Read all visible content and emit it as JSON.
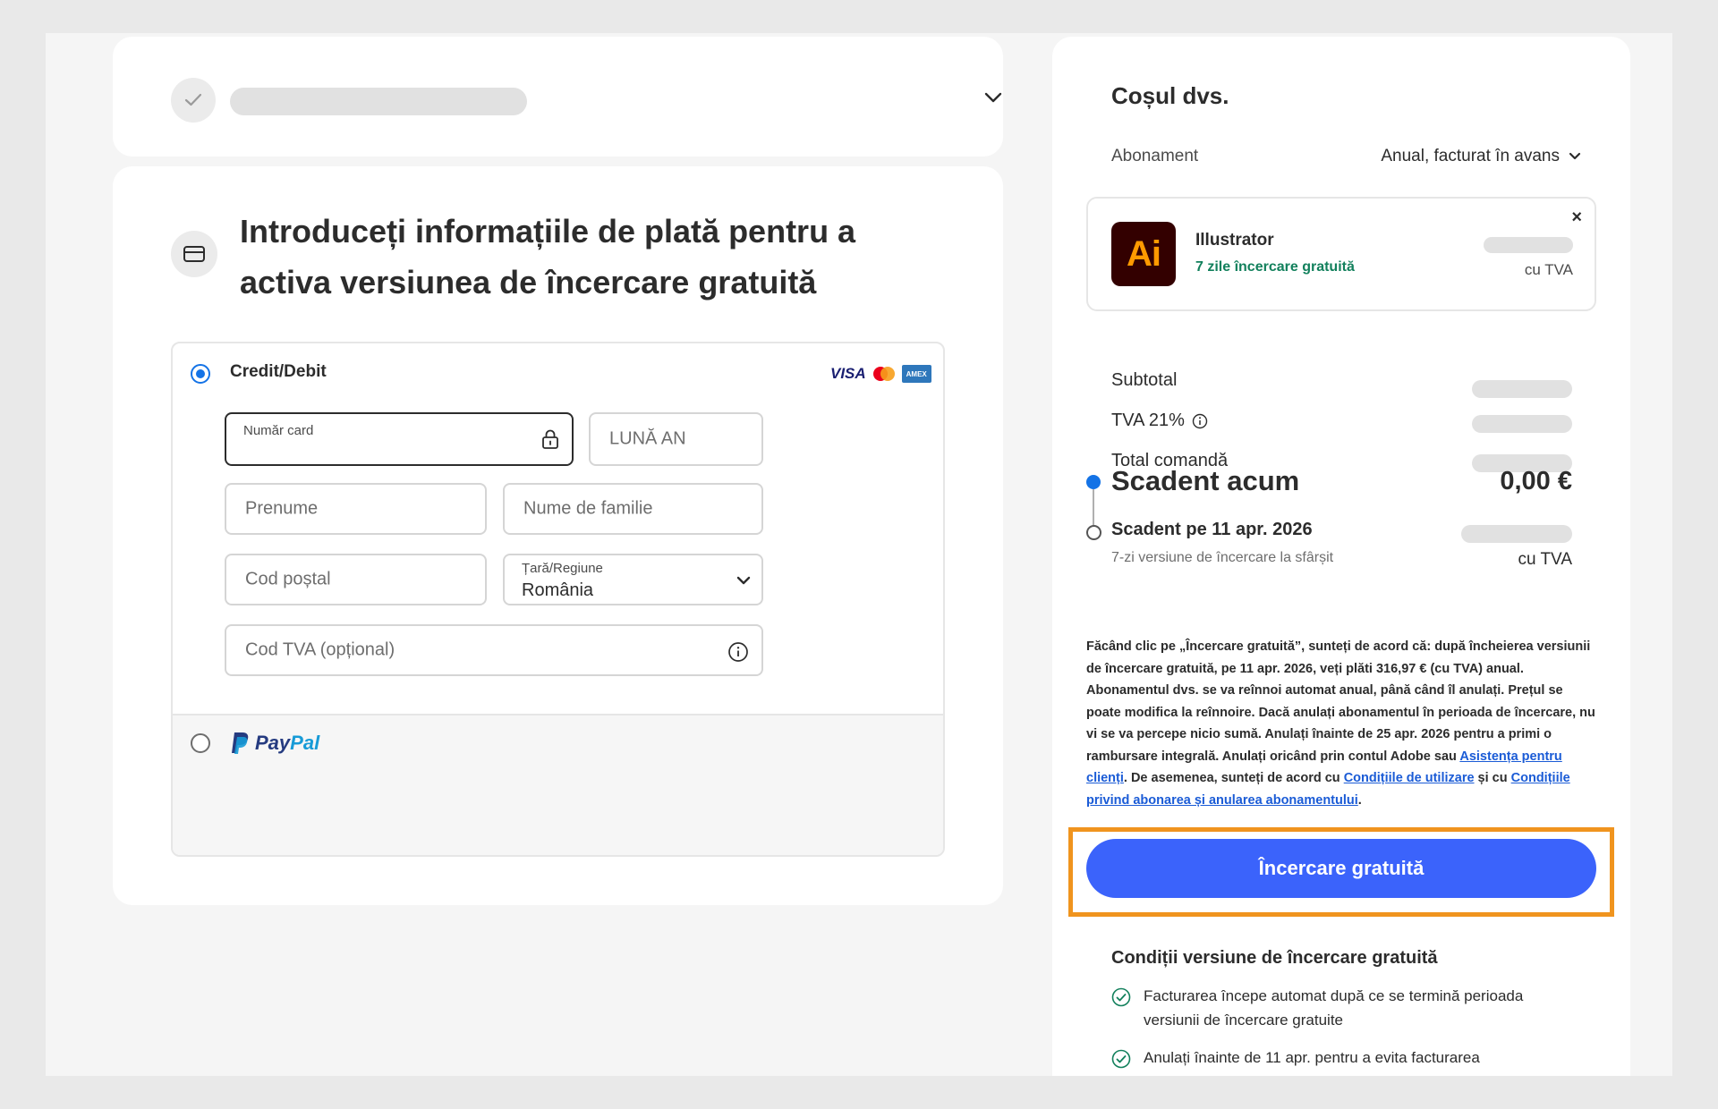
{
  "step_payment": {
    "title": "Introduceți informațiile de plată pentru a activa versiunea de încercare gratuită",
    "method_card": {
      "label": "Credit/Debit",
      "brands": [
        "VISA",
        "Mastercard",
        "American Express"
      ],
      "amex_text": "AMEX"
    },
    "fields": {
      "card_number_label": "Număr card",
      "expiry_placeholder": "LUNĂ AN",
      "first_name_placeholder": "Prenume",
      "last_name_placeholder": "Nume de familie",
      "postal_code_placeholder": "Cod poștal",
      "country_label": "Țară/Regiune",
      "country_value": "România",
      "vat_placeholder": "Cod TVA (opțional)"
    },
    "method_paypal": {
      "label_part1": "Pay",
      "label_part2": "Pal"
    }
  },
  "cart": {
    "title": "Coșul dvs.",
    "subscription_label": "Abonament",
    "subscription_value": "Anual, facturat în avans",
    "product": {
      "name": "Illustrator",
      "logo_text": "Ai",
      "trial": "7 zile încercare gratuită",
      "tax": "cu TVA",
      "close": "×"
    },
    "subtotal_label": "Subtotal",
    "vat_label": "TVA 21%",
    "total_label": "Total comandă",
    "due_now_label": "Scadent acum",
    "due_now_amount": "0,00 €",
    "due_later_label": "Scadent pe 11 apr. 2026",
    "due_later_sub": "7-zi versiune de încercare la sfârșit",
    "due_later_tax": "cu TVA",
    "legal": {
      "text1": "Făcând clic pe „Încercare gratuită”, sunteți de acord că: după încheierea versiunii de încercare gratuită, pe 11 apr. 2026, veți plăti 316,97 € (cu TVA) anual. Abonamentul dvs. se va reînnoi automat anual, până când îl anulați. Prețul se poate modifica la reînnoire. Dacă anulați abonamentul în perioada de încercare, nu vi se va percepe nicio sumă. Anulați înainte de 25 apr. 2026 pentru a primi o rambursare integrală. Anulați oricând prin contul Adobe sau ",
      "link1": "Asistența pentru clienți",
      "text2": ". De asemenea, sunteți de acord cu ",
      "link2": "Condițiile de utilizare",
      "text3": " și cu ",
      "link3": "Condițiile privind abonarea și anularea abonamentului",
      "text4": "."
    },
    "cta_label": "Încercare gratuită",
    "conditions_title": "Condiții versiune de încercare gratuită",
    "conditions": [
      "Facturarea începe automat după ce se termină perioada versiunii de încercare gratuite",
      "Anulați înainte de 11 apr. pentru a evita facturarea"
    ]
  },
  "colors": {
    "accent_blue": "#3b63fb",
    "radio_blue": "#1473e6",
    "trial_green": "#12805c",
    "highlight_orange": "#f0941e",
    "illustrator_bg": "#330000",
    "illustrator_fg": "#ff9a00"
  },
  "icons": [
    "checkmark-icon",
    "chevron-down-icon",
    "credit-card-icon",
    "lock-icon",
    "info-icon",
    "close-icon",
    "check-circle-icon"
  ]
}
